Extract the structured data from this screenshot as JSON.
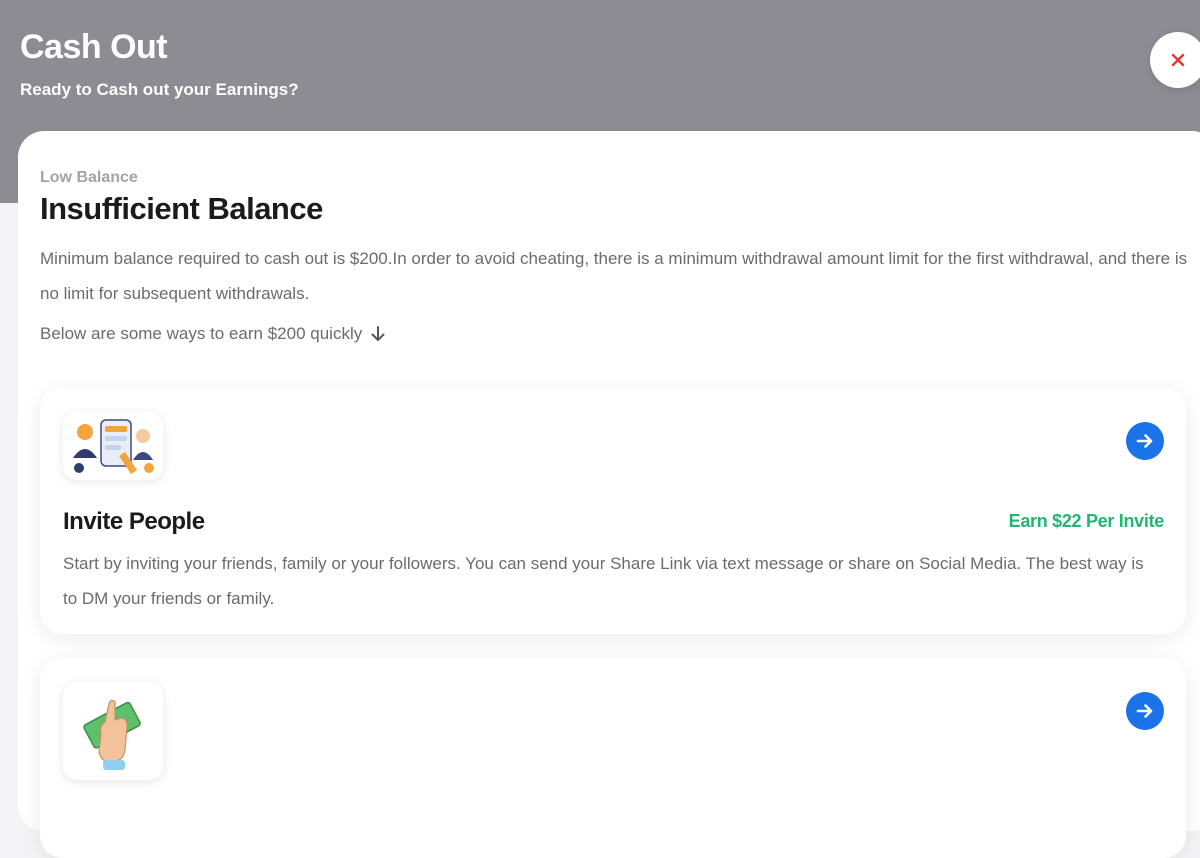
{
  "header": {
    "title": "Cash Out",
    "subtitle": "Ready to Cash out your Earnings?",
    "close_icon": "close-icon"
  },
  "notice": {
    "eyebrow": "Low Balance",
    "title": "Insufficient Balance",
    "description": "Minimum balance required to cash out is $200.In order to avoid cheating, there is a minimum withdrawal amount limit for the first withdrawal, and there is no limit for subsequent withdrawals.",
    "hint": "Below are some ways to earn $200 quickly",
    "hint_icon": "arrow-down-icon"
  },
  "cards": [
    {
      "image": "invite-people-illustration",
      "title": "Invite People",
      "reward": "Earn $22 Per Invite",
      "description": "Start by inviting your friends, family or your followers. You can send your Share Link via text message or share on Social Media. The best way is to DM your friends or family.",
      "action_icon": "arrow-right-circle-icon"
    },
    {
      "image": "hand-with-cash-illustration",
      "action_icon": "arrow-right-circle-icon"
    }
  ],
  "colors": {
    "header_bg": "#8c8c92",
    "accent_blue": "#1a73e8",
    "reward_green": "#22b573",
    "close_red": "#e53935"
  }
}
